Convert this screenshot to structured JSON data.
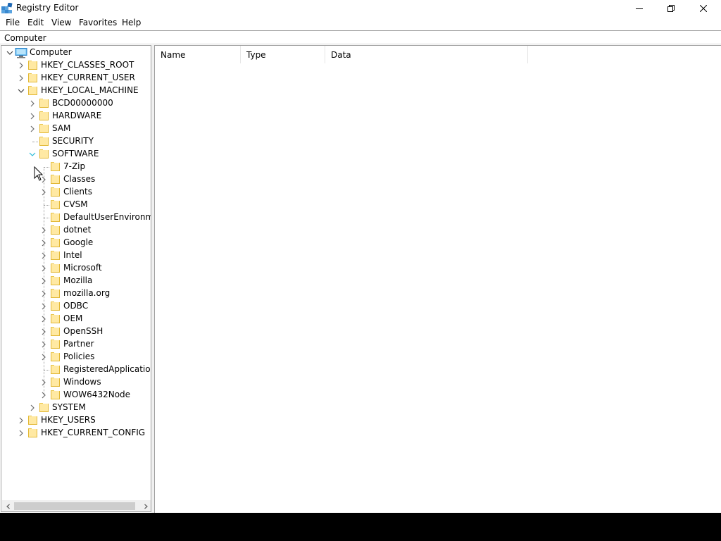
{
  "window": {
    "title": "Registry Editor",
    "controls": {
      "minimize": "minimize",
      "maximize": "restore",
      "close": "close"
    }
  },
  "menu": [
    "File",
    "Edit",
    "View",
    "Favorites",
    "Help"
  ],
  "address": "Computer",
  "tree": {
    "root": "Computer",
    "hives": [
      {
        "label": "HKEY_CLASSES_ROOT",
        "expanded": false
      },
      {
        "label": "HKEY_CURRENT_USER",
        "expanded": false
      },
      {
        "label": "HKEY_LOCAL_MACHINE",
        "expanded": true,
        "children": [
          {
            "label": "BCD00000000",
            "has_children": true
          },
          {
            "label": "HARDWARE",
            "has_children": true
          },
          {
            "label": "SAM",
            "has_children": true
          },
          {
            "label": "SECURITY",
            "has_children": false
          },
          {
            "label": "SOFTWARE",
            "expanded": true,
            "children": [
              {
                "label": "7-Zip",
                "has_children": false
              },
              {
                "label": "Classes",
                "has_children": true
              },
              {
                "label": "Clients",
                "has_children": true
              },
              {
                "label": "CVSM",
                "has_children": false
              },
              {
                "label": "DefaultUserEnvironmen",
                "has_children": false
              },
              {
                "label": "dotnet",
                "has_children": true
              },
              {
                "label": "Google",
                "has_children": true
              },
              {
                "label": "Intel",
                "has_children": true
              },
              {
                "label": "Microsoft",
                "has_children": true
              },
              {
                "label": "Mozilla",
                "has_children": true
              },
              {
                "label": "mozilla.org",
                "has_children": true
              },
              {
                "label": "ODBC",
                "has_children": true
              },
              {
                "label": "OEM",
                "has_children": true
              },
              {
                "label": "OpenSSH",
                "has_children": true
              },
              {
                "label": "Partner",
                "has_children": true
              },
              {
                "label": "Policies",
                "has_children": true
              },
              {
                "label": "RegisteredApplications",
                "has_children": false
              },
              {
                "label": "Windows",
                "has_children": true
              },
              {
                "label": "WOW6432Node",
                "has_children": true
              }
            ]
          },
          {
            "label": "SYSTEM",
            "has_children": true
          }
        ]
      },
      {
        "label": "HKEY_USERS",
        "expanded": false
      },
      {
        "label": "HKEY_CURRENT_CONFIG",
        "expanded": false
      }
    ]
  },
  "list": {
    "columns": [
      "Name",
      "Type",
      "Data"
    ]
  },
  "colors": {
    "accent": "#0078d7",
    "folder_fill": "#ffe9a3",
    "folder_edge": "#e2b836",
    "chevron": "#6d6d6d",
    "chevron_hot": "#2bbbd8"
  },
  "icons": {
    "app": "registry-editor-icon",
    "computer": "computer-icon",
    "folder": "folder-icon",
    "collapsed": "chevron-right-icon",
    "expanded": "chevron-down-icon"
  }
}
